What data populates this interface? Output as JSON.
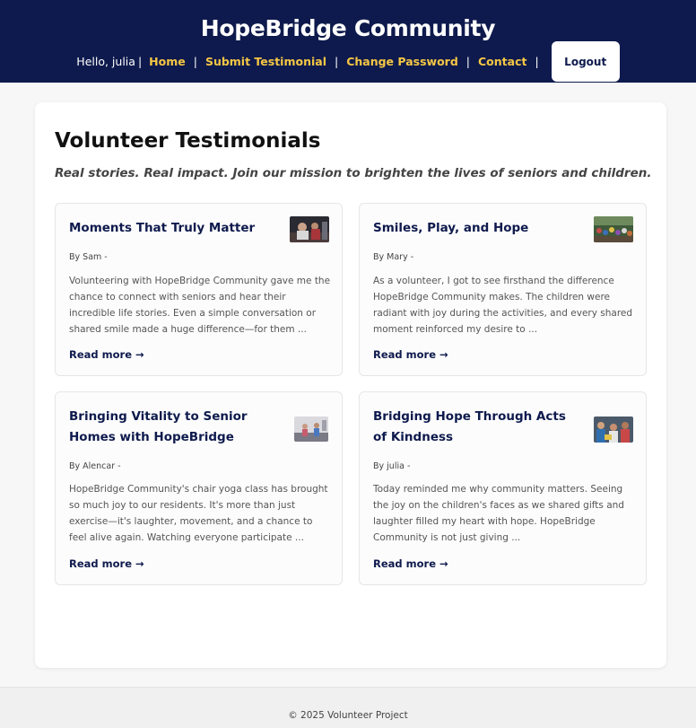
{
  "header": {
    "site_title": "HopeBridge Community",
    "greeting": "Hello, julia",
    "nav": [
      "Home",
      "Submit Testimonial",
      "Change Password",
      "Contact"
    ],
    "logout_label": "Logout"
  },
  "main": {
    "title": "Volunteer Testimonials",
    "subtitle": "Real stories. Real impact. Join our mission to brighten the lives of seniors and children."
  },
  "testimonials": [
    {
      "title": "Moments That Truly Matter",
      "author": "By Sam -",
      "excerpt": "Volunteering with HopeBridge Community gave me the chance to connect with seniors and hear their incredible life stories. Even a simple conversation or shared smile made a huge difference—for them ...",
      "read_more": "Read more →"
    },
    {
      "title": "Smiles, Play, and Hope",
      "author": "By Mary -",
      "excerpt": "As a volunteer, I got to see firsthand the difference HopeBridge Community makes. The children were radiant with joy during the activities, and every shared moment reinforced my desire to ...",
      "read_more": "Read more →"
    },
    {
      "title": "Bringing Vitality to Senior Homes with HopeBridge",
      "author": "By Alencar -",
      "excerpt": "HopeBridge Community's chair yoga class has brought so much joy to our residents. It's more than just exercise—it's laughter, movement, and a chance to feel alive again. Watching everyone participate ...",
      "read_more": "Read more →"
    },
    {
      "title": "Bridging Hope Through Acts of Kindness",
      "author": "By julia -",
      "excerpt": "Today reminded me why community matters. Seeing the joy on the children's faces as we shared gifts and laughter filled my heart with hope. HopeBridge Community is not just giving ...",
      "read_more": "Read more →"
    }
  ],
  "footer": {
    "copyright": "© 2025 Volunteer Project"
  }
}
